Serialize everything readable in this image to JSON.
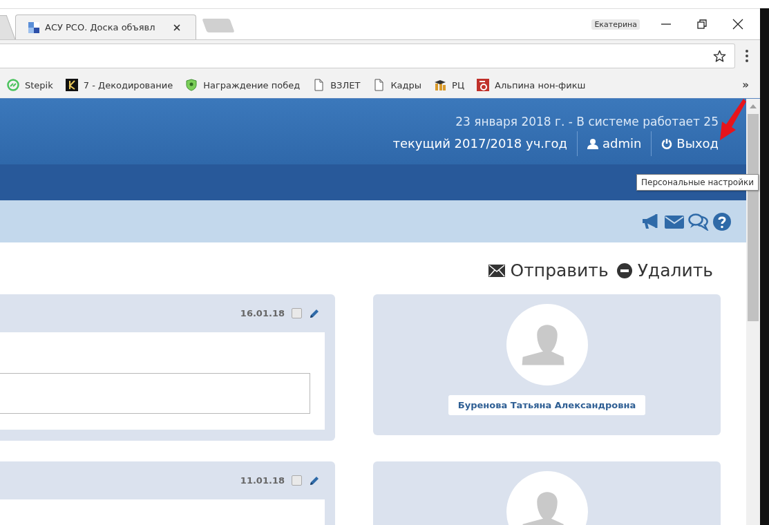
{
  "browser": {
    "tab": {
      "title": "АСУ РСО. Доска объявл",
      "selected": true
    },
    "profile_name": "Екатерина",
    "bookmarks": [
      {
        "label": "Stepik",
        "kind": "stepik"
      },
      {
        "label": "7 - Декодирование",
        "kind": "letter-k"
      },
      {
        "label": "Награждение побед",
        "kind": "shield"
      },
      {
        "label": "ВЗЛЕТ",
        "kind": "page"
      },
      {
        "label": "Кадры",
        "kind": "page"
      },
      {
        "label": "РЦ",
        "kind": "cap"
      },
      {
        "label": "Альпина нон-фикш",
        "kind": "letter-a"
      }
    ],
    "bookmarks_more": "»"
  },
  "header": {
    "date_line": "23 января 2018 г. - В системе работает 25",
    "school_year": "текущий 2017/2018 уч.год",
    "user": "admin",
    "logout": "Выход"
  },
  "tooltip": "Персональные настройки",
  "actions": [
    {
      "label": "Отправить",
      "kind": "send"
    },
    {
      "label": "Удалить",
      "kind": "delete"
    }
  ],
  "posts": [
    {
      "date": "16.01.18",
      "checked": false,
      "author": "Буренова Татьяна Александровна"
    },
    {
      "date": "11.01.18",
      "checked": false
    }
  ]
}
